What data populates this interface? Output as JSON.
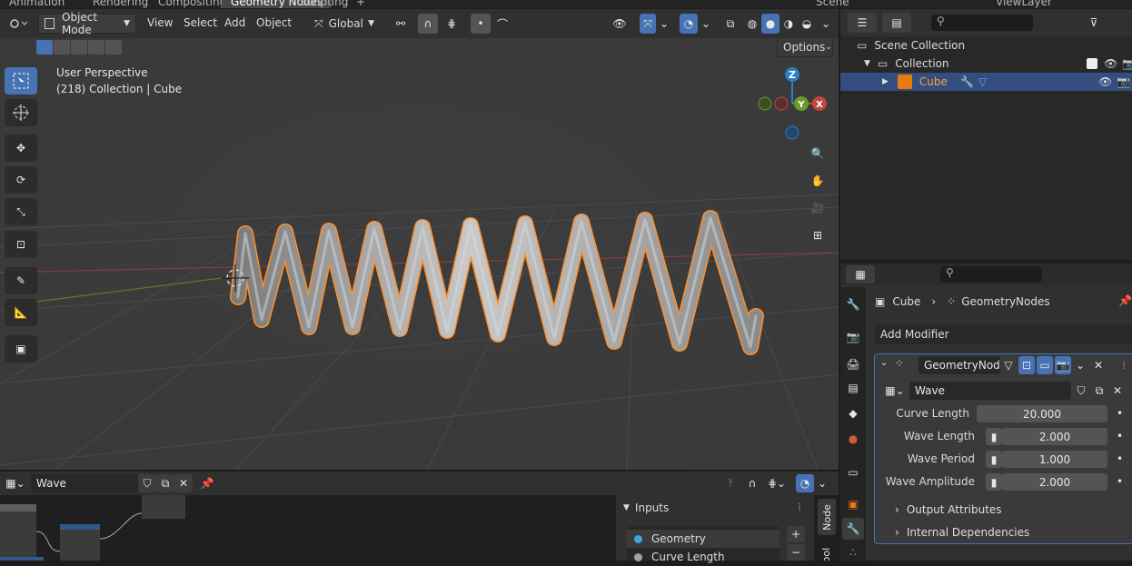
{
  "workspace_tabs": [
    "Animation",
    "Rendering",
    "Compositing",
    "Geometry Nodes",
    "Scripting"
  ],
  "top_right": {
    "scene": "Scene",
    "view_layer": "ViewLayer"
  },
  "viewport_header": {
    "mode": "Object Mode",
    "menus": [
      "View",
      "Select",
      "Add",
      "Object"
    ],
    "orientation": "Global",
    "options": "Options"
  },
  "viewport": {
    "perspective": "User Perspective",
    "context": "(218) Collection | Cube",
    "gizmo_labels": {
      "z": "Z",
      "x": "X",
      "y": "Y"
    }
  },
  "outliner": {
    "items": [
      {
        "label": "Scene Collection"
      },
      {
        "label": "Collection"
      },
      {
        "label": "Cube"
      }
    ]
  },
  "properties": {
    "breadcrumb_object": "Cube",
    "breadcrumb_modifier": "GeometryNodes",
    "add_modifier": "Add Modifier",
    "modifier_name": "GeometryNod...",
    "node_group": "Wave",
    "fields": [
      {
        "label": "Curve Length",
        "value": "20.000"
      },
      {
        "label": "Wave Length",
        "value": "2.000"
      },
      {
        "label": "Wave Period",
        "value": "1.000"
      },
      {
        "label": "Wave Amplitude",
        "value": "2.000"
      }
    ],
    "panels": [
      "Output Attributes",
      "Internal Dependencies"
    ]
  },
  "node_editor": {
    "node_group": "Wave",
    "side_panel_title": "Inputs",
    "inputs": [
      "Geometry",
      "Curve Length"
    ],
    "side_tab_node": "Node",
    "side_tab_tool": "Tool"
  },
  "colors": {
    "accent": "#4772b3",
    "selection": "#ff8f2a",
    "panel": "#303030"
  }
}
